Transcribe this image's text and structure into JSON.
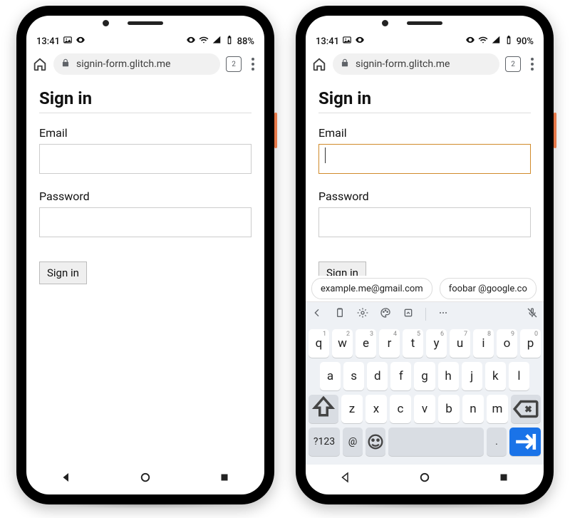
{
  "phones": [
    {
      "status": {
        "time": "13:41",
        "battery": "88%"
      },
      "url": "signin-form.glitch.me",
      "tab_count": "2",
      "page": {
        "title": "Sign in",
        "email_label": "Email",
        "password_label": "Password",
        "submit_label": "Sign in"
      },
      "email_focused": false,
      "keyboard": false
    },
    {
      "status": {
        "time": "13:41",
        "battery": "90%"
      },
      "url": "signin-form.glitch.me",
      "tab_count": "2",
      "page": {
        "title": "Sign in",
        "email_label": "Email",
        "password_label": "Password",
        "submit_label": "Sign in"
      },
      "email_focused": true,
      "keyboard": true,
      "suggestions": [
        "example.me@gmail.com",
        "foobar @google.co"
      ],
      "kb": {
        "row1": [
          [
            "q",
            "1"
          ],
          [
            "w",
            "2"
          ],
          [
            "e",
            "3"
          ],
          [
            "r",
            "4"
          ],
          [
            "t",
            "5"
          ],
          [
            "y",
            "6"
          ],
          [
            "u",
            "7"
          ],
          [
            "i",
            "8"
          ],
          [
            "o",
            "9"
          ],
          [
            "p",
            "0"
          ]
        ],
        "row2": [
          "a",
          "s",
          "d",
          "f",
          "g",
          "h",
          "j",
          "k",
          "l"
        ],
        "row3": [
          "z",
          "x",
          "c",
          "v",
          "b",
          "n",
          "m"
        ],
        "fn": "?123",
        "at": "@",
        "dot": "."
      }
    }
  ]
}
